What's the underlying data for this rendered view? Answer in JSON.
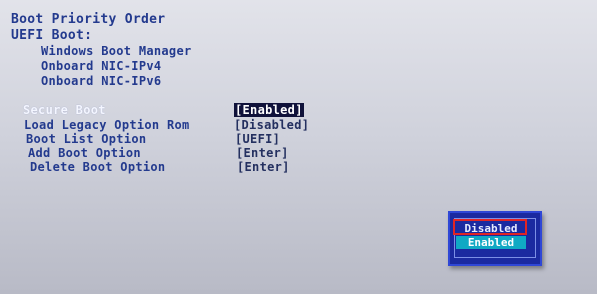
{
  "boot_priority": {
    "title": "Boot Priority Order",
    "uefi_label": "UEFI Boot:",
    "items": [
      "Windows Boot Manager",
      "Onboard NIC-IPv4",
      "Onboard NIC-IPv6"
    ]
  },
  "settings": [
    {
      "label": "Secure Boot",
      "value": "[Enabled]"
    },
    {
      "label": "Load Legacy Option Rom",
      "value": "[Disabled]"
    },
    {
      "label": "Boot List Option",
      "value": "[UEFI]"
    },
    {
      "label": "Add Boot Option",
      "value": "[Enter]"
    },
    {
      "label": "Delete Boot Option",
      "value": "[Enter]"
    }
  ],
  "popup": {
    "options": [
      "Disabled",
      "Enabled"
    ],
    "highlighted": "Enabled",
    "focused": "Disabled"
  },
  "colors": {
    "text": "#233a8e",
    "popup_bg": "#1b2aa0",
    "popup_highlight": "#10a9c4",
    "focus_ring": "#e02424"
  }
}
